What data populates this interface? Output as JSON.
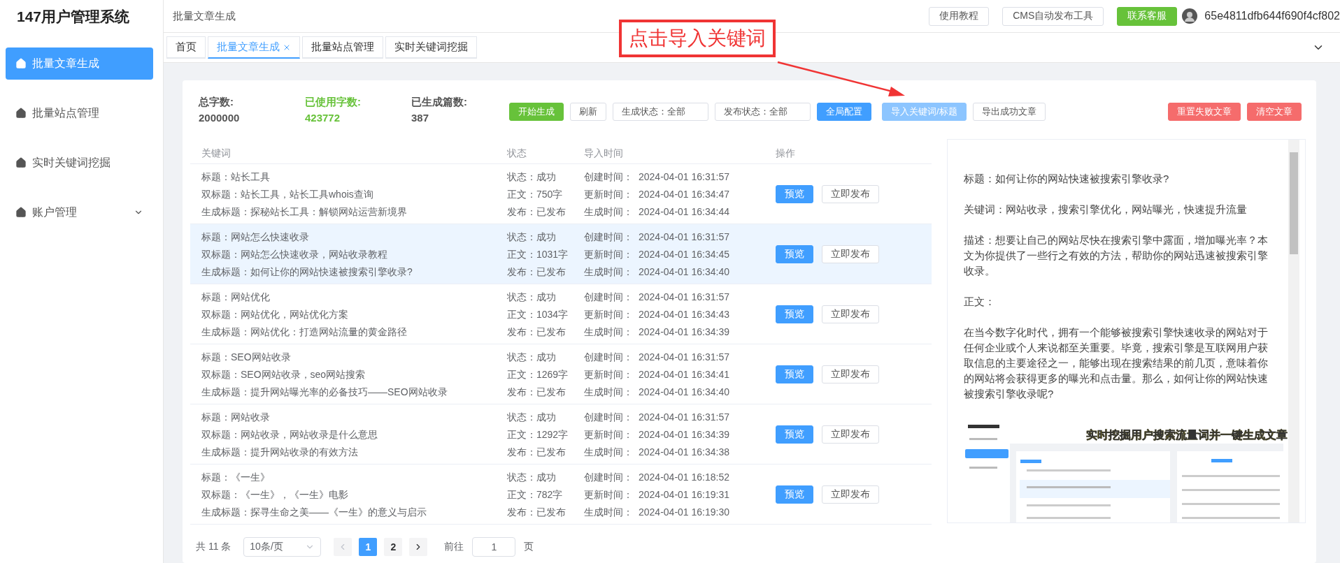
{
  "app_title": "147用户管理系统",
  "sidebar": {
    "items": [
      {
        "label": "批量文章生成",
        "selected": true,
        "expandable": false
      },
      {
        "label": "批量站点管理",
        "selected": false,
        "expandable": false
      },
      {
        "label": "实时关键词挖掘",
        "selected": false,
        "expandable": false
      },
      {
        "label": "账户管理",
        "selected": false,
        "expandable": true
      }
    ]
  },
  "header": {
    "breadcrumb": "批量文章生成",
    "buttons": [
      {
        "label": "使用教程",
        "kind": "default"
      },
      {
        "label": "CMS自动发布工具",
        "kind": "default"
      },
      {
        "label": "联系客服",
        "kind": "success"
      }
    ],
    "user": "65e4811dfb644f690f4cf802"
  },
  "tabs": [
    {
      "label": "首页",
      "selected": false
    },
    {
      "label": "批量文章生成",
      "selected": true
    },
    {
      "label": "批量站点管理",
      "selected": false
    },
    {
      "label": "实时关键词挖掘",
      "selected": false
    }
  ],
  "annotation": {
    "text": "点击导入关键词"
  },
  "stats": [
    {
      "label": "总字数:",
      "value": "2000000",
      "highlight": false
    },
    {
      "label": "已使用字数:",
      "value": "423772",
      "highlight": true
    },
    {
      "label": "已生成篇数:",
      "value": "387",
      "highlight": false
    }
  ],
  "toolbar": [
    {
      "label": "开始生成",
      "kind": "success"
    },
    {
      "label": "刷新",
      "kind": "default"
    },
    {
      "label": "生成状态：全部",
      "kind": "select"
    },
    {
      "label": "发布状态：全部",
      "kind": "select"
    },
    {
      "label": "全局配置",
      "kind": "primary"
    },
    {
      "label": "导入关键词/标题",
      "kind": "primary-light"
    },
    {
      "label": "导出成功文章",
      "kind": "default"
    }
  ],
  "toolbar_right": [
    {
      "label": "重置失败文章",
      "kind": "danger"
    },
    {
      "label": "清空文章",
      "kind": "danger"
    }
  ],
  "table": {
    "columns": [
      "关键词",
      "状态",
      "导入时间",
      "操作"
    ],
    "rows": [
      {
        "highlighted": false,
        "keyword": [
          "标题：站长工具",
          "双标题：站长工具，站长工具whois查询",
          "生成标题：探秘站长工具：解锁网站运营新境界"
        ],
        "status": [
          "状态：成功",
          "正文：750字",
          "发布：已发布"
        ],
        "times": [
          {
            "label": "创建时间：",
            "value": "2024-04-01 16:31:57"
          },
          {
            "label": "更新时间：",
            "value": "2024-04-01 16:34:47"
          },
          {
            "label": "生成时间：",
            "value": "2024-04-01 16:34:44"
          }
        ],
        "actions": [
          "预览",
          "立即发布"
        ]
      },
      {
        "highlighted": true,
        "keyword": [
          "标题：网站怎么快速收录",
          "双标题：网站怎么快速收录，网站收录教程",
          "生成标题：如何让你的网站快速被搜索引擎收录?"
        ],
        "status": [
          "状态：成功",
          "正文：1031字",
          "发布：已发布"
        ],
        "times": [
          {
            "label": "创建时间：",
            "value": "2024-04-01 16:31:57"
          },
          {
            "label": "更新时间：",
            "value": "2024-04-01 16:34:45"
          },
          {
            "label": "生成时间：",
            "value": "2024-04-01 16:34:40"
          }
        ],
        "actions": [
          "预览",
          "立即发布"
        ]
      },
      {
        "highlighted": false,
        "keyword": [
          "标题：网站优化",
          "双标题：网站优化，网站优化方案",
          "生成标题：网站优化：打造网站流量的黄金路径"
        ],
        "status": [
          "状态：成功",
          "正文：1034字",
          "发布：已发布"
        ],
        "times": [
          {
            "label": "创建时间：",
            "value": "2024-04-01 16:31:57"
          },
          {
            "label": "更新时间：",
            "value": "2024-04-01 16:34:43"
          },
          {
            "label": "生成时间：",
            "value": "2024-04-01 16:34:39"
          }
        ],
        "actions": [
          "预览",
          "立即发布"
        ]
      },
      {
        "highlighted": false,
        "keyword": [
          "标题：SEO网站收录",
          "双标题：SEO网站收录，seo网站搜索",
          "生成标题：提升网站曝光率的必备技巧——SEO网站收录"
        ],
        "status": [
          "状态：成功",
          "正文：1269字",
          "发布：已发布"
        ],
        "times": [
          {
            "label": "创建时间：",
            "value": "2024-04-01 16:31:57"
          },
          {
            "label": "更新时间：",
            "value": "2024-04-01 16:34:41"
          },
          {
            "label": "生成时间：",
            "value": "2024-04-01 16:34:40"
          }
        ],
        "actions": [
          "预览",
          "立即发布"
        ]
      },
      {
        "highlighted": false,
        "keyword": [
          "标题：网站收录",
          "双标题：网站收录，网站收录是什么意思",
          "生成标题：提升网站收录的有效方法"
        ],
        "status": [
          "状态：成功",
          "正文：1292字",
          "发布：已发布"
        ],
        "times": [
          {
            "label": "创建时间：",
            "value": "2024-04-01 16:31:57"
          },
          {
            "label": "更新时间：",
            "value": "2024-04-01 16:34:39"
          },
          {
            "label": "生成时间：",
            "value": "2024-04-01 16:34:38"
          }
        ],
        "actions": [
          "预览",
          "立即发布"
        ]
      },
      {
        "highlighted": false,
        "keyword": [
          "标题：《一生》",
          "双标题：《一生》，《一生》电影",
          "生成标题：探寻生命之美——《一生》的意义与启示"
        ],
        "status": [
          "状态：成功",
          "正文：782字",
          "发布：已发布"
        ],
        "times": [
          {
            "label": "创建时间：",
            "value": "2024-04-01 16:18:52"
          },
          {
            "label": "更新时间：",
            "value": "2024-04-01 16:19:31"
          },
          {
            "label": "生成时间：",
            "value": "2024-04-01 16:19:30"
          }
        ],
        "actions": [
          "预览",
          "立即发布"
        ]
      }
    ]
  },
  "preview": {
    "paragraphs": [
      "标题：如何让你的网站快速被搜索引擎收录?",
      "关键词：网站收录，搜索引擎优化，网站曝光，快速提升流量",
      "描述：想要让自己的网站尽快在搜索引擎中露面，增加曝光率？本文为你提供了一些行之有效的方法，帮助你的网站迅速被搜索引擎收录。",
      "正文：",
      "在当今数字化时代，拥有一个能够被搜索引擎快速收录的网站对于任何企业或个人来说都至关重要。毕竟，搜索引擎是互联网用户获取信息的主要途径之一，能够出现在搜索结果的前几页，意味着你的网站将会获得更多的曝光和点击量。那么，如何让你的网站快速被搜索引擎收录呢?"
    ],
    "screenshot_caption": "实时挖掘用户搜索流量词并一键生成文章"
  },
  "pagination": {
    "total": "共 11 条",
    "page_size": "10条/页",
    "prev_disabled": true,
    "next_disabled": false,
    "pages": [
      {
        "label": "1",
        "selected": true
      },
      {
        "label": "2",
        "selected": false
      }
    ],
    "goto_label": "前往",
    "goto_value": "1",
    "goto_suffix": "页"
  }
}
